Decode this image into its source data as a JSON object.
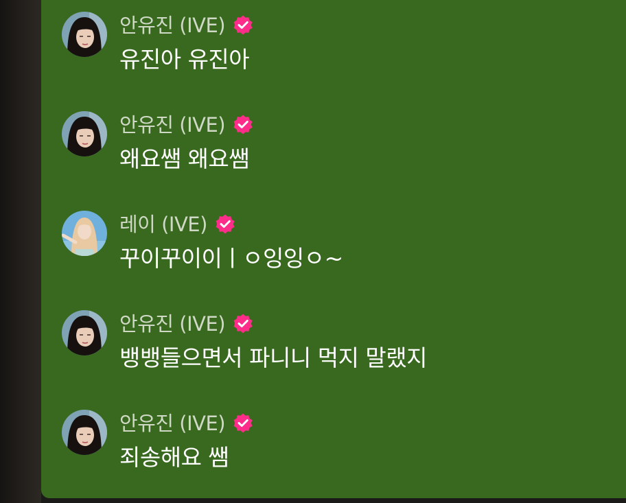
{
  "colors": {
    "panel_bg": "#38691f",
    "name_text": "#cfd9c6",
    "message_text": "#ffffff",
    "verified_badge": "#ff2d8a"
  },
  "messages": [
    {
      "sender": "안유진 (IVE)",
      "avatar": "yujin",
      "verified": true,
      "text": "유진아 유진아"
    },
    {
      "sender": "안유진 (IVE)",
      "avatar": "yujin",
      "verified": true,
      "text": "왜요쌤 왜요쌤"
    },
    {
      "sender": "레이 (IVE)",
      "avatar": "rei",
      "verified": true,
      "text": "꾸이꾸이이ㅣㅇ잉잉ㅇ~"
    },
    {
      "sender": "안유진 (IVE)",
      "avatar": "yujin",
      "verified": true,
      "text": "뱅뱅들으면서 파니니 먹지 말랬지"
    },
    {
      "sender": "안유진 (IVE)",
      "avatar": "yujin",
      "verified": true,
      "text": "죄송해요 쌤"
    }
  ]
}
